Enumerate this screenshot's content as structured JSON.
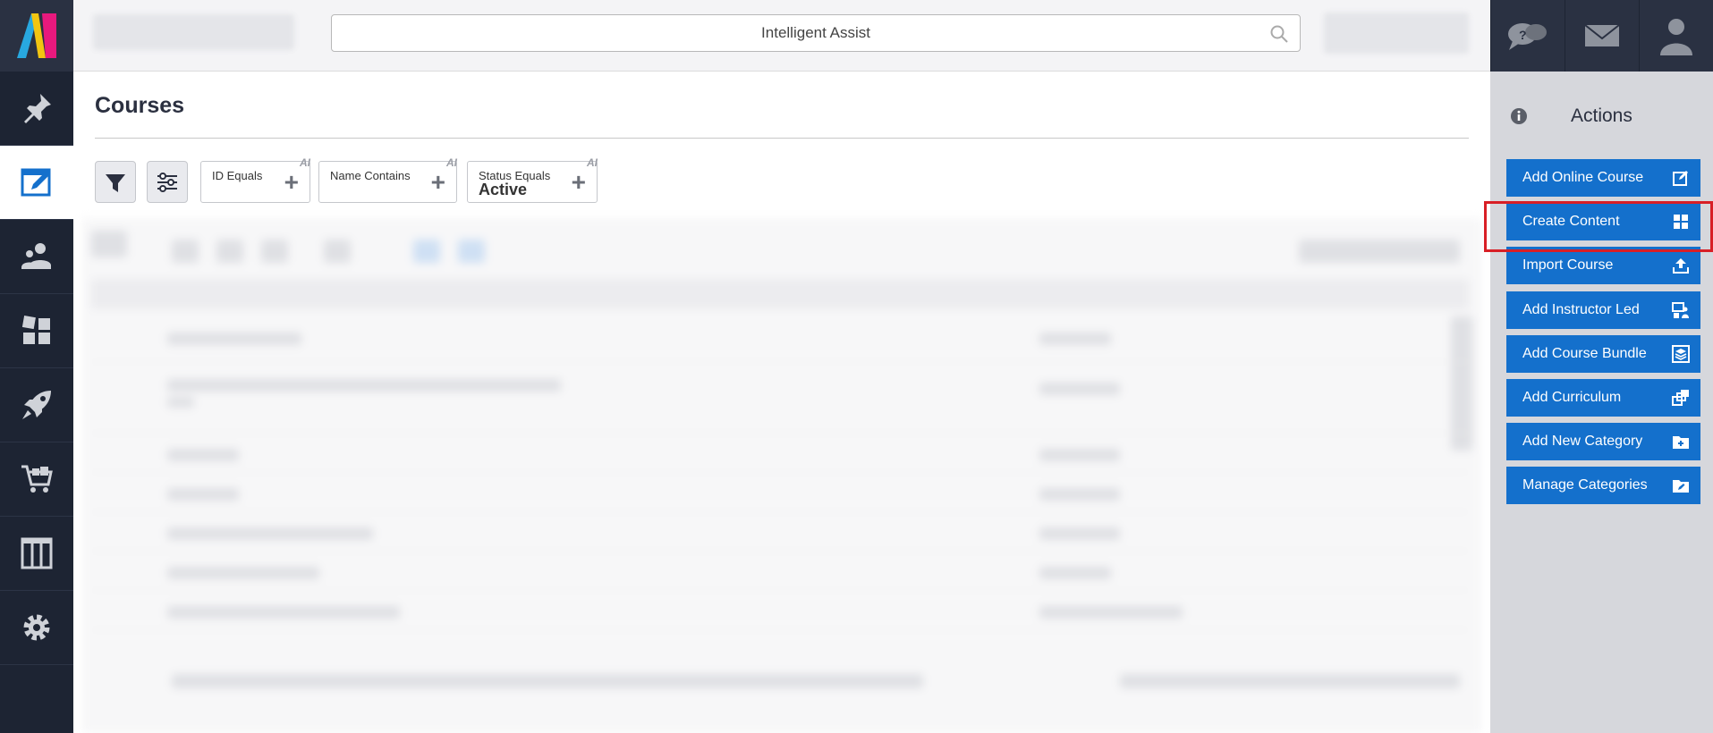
{
  "search": {
    "placeholder": "Intelligent Assist",
    "icon": "search-icon"
  },
  "leftnav": {
    "items": [
      {
        "name": "pin",
        "icon": "pin-icon",
        "active": false
      },
      {
        "name": "courses",
        "icon": "edit-window-icon",
        "active": true
      },
      {
        "name": "users",
        "icon": "users-icon",
        "active": false
      },
      {
        "name": "dashboard",
        "icon": "tiles-icon",
        "active": false
      },
      {
        "name": "launch",
        "icon": "rocket-icon",
        "active": false
      },
      {
        "name": "store",
        "icon": "cart-icon",
        "active": false
      },
      {
        "name": "reports",
        "icon": "columns-icon",
        "active": false
      },
      {
        "name": "settings",
        "icon": "gear-icon",
        "active": false
      }
    ]
  },
  "topicons": [
    "help-chat-icon",
    "mail-icon",
    "user-icon"
  ],
  "page": {
    "title": "Courses"
  },
  "filters": [
    {
      "label": "ID Equals",
      "value": "",
      "badge": "AI"
    },
    {
      "label": "Name Contains",
      "value": "",
      "badge": "AI"
    },
    {
      "label": "Status Equals",
      "value": "Active",
      "badge": "AI"
    }
  ],
  "actions": {
    "title": "Actions",
    "buttons": [
      {
        "label": "Add Online Course",
        "icon": "edit-icon"
      },
      {
        "label": "Create Content",
        "icon": "tiles-icon",
        "highlighted": true
      },
      {
        "label": "Import Course",
        "icon": "upload-icon"
      },
      {
        "label": "Add Instructor Led",
        "icon": "instructor-icon"
      },
      {
        "label": "Add Course Bundle",
        "icon": "bundle-icon"
      },
      {
        "label": "Add Curriculum",
        "icon": "curriculum-icon"
      },
      {
        "label": "Add New Category",
        "icon": "folder-plus-icon"
      },
      {
        "label": "Manage Categories",
        "icon": "folder-edit-icon"
      }
    ]
  },
  "colors": {
    "accent": "#1470cc",
    "nav": "#1d2433",
    "highlight": "#d81f26"
  }
}
